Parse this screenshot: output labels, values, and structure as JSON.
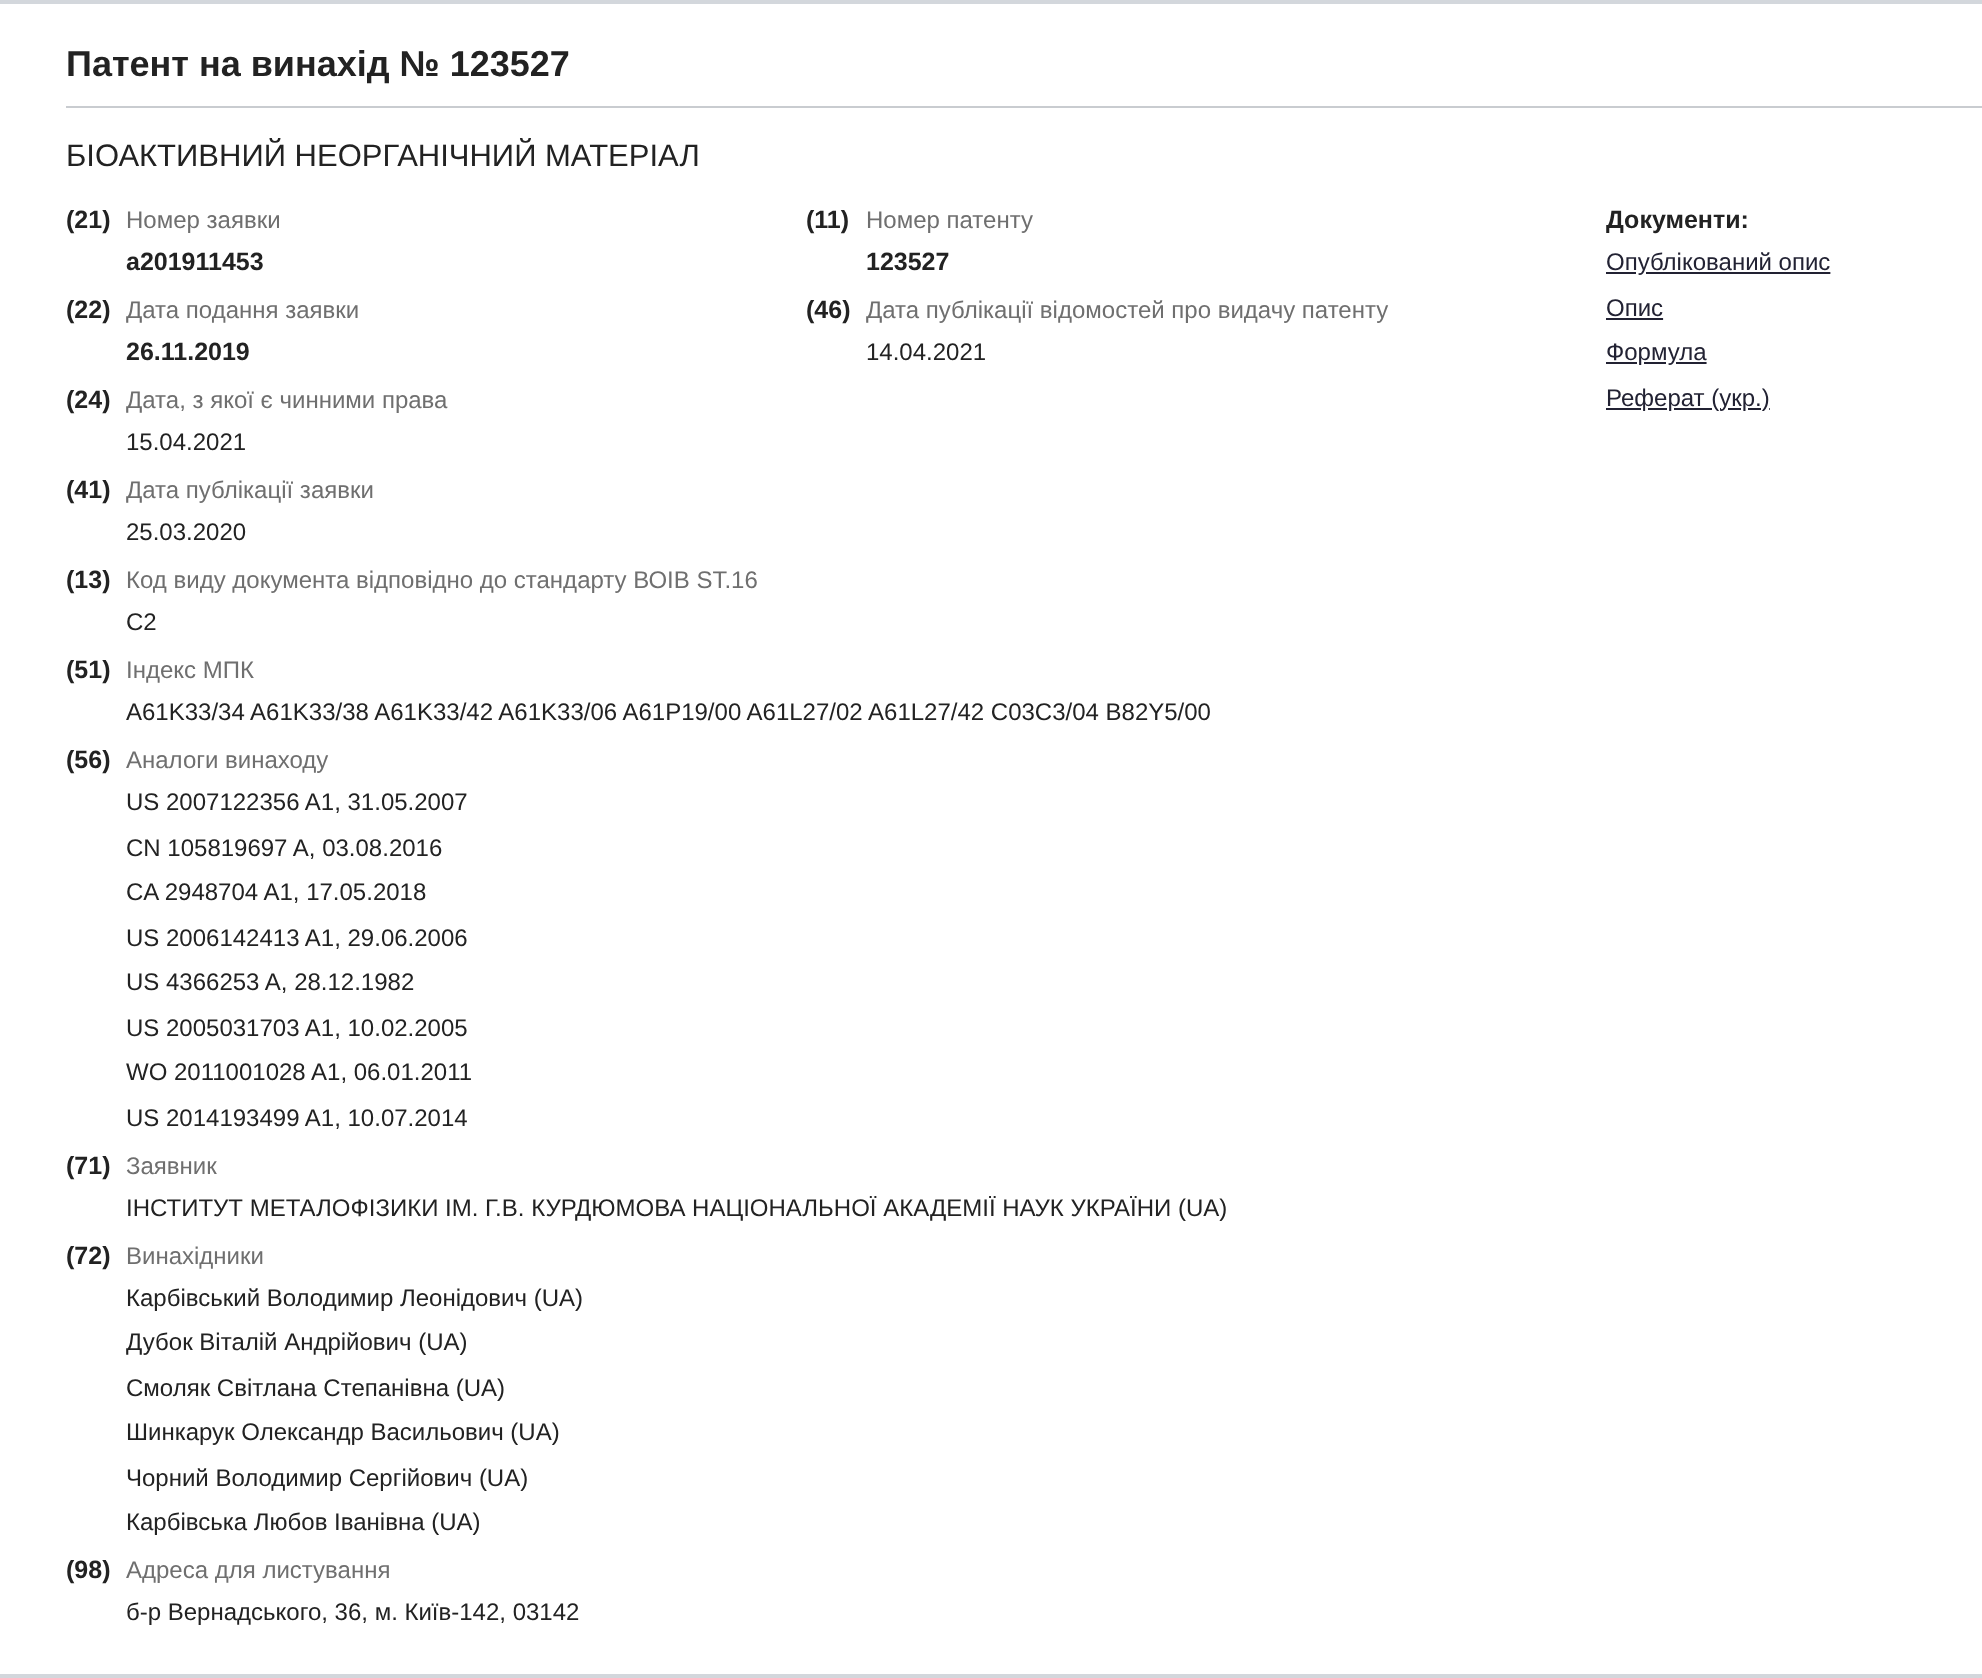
{
  "page_title": "Патент на винахід № 123527",
  "invention_title": "БІОАКТИВНИЙ НЕОРГАНІЧНИЙ МАТЕРІАЛ",
  "top_left_fields": [
    {
      "code": "(21)",
      "label": "Номер заявки",
      "bold": true,
      "values": [
        "a201911453"
      ]
    },
    {
      "code": "(22)",
      "label": "Дата подання заявки",
      "bold": true,
      "values": [
        "26.11.2019"
      ]
    }
  ],
  "top_right_fields": [
    {
      "code": "(11)",
      "label": "Номер патенту",
      "bold": true,
      "values": [
        "123527"
      ]
    },
    {
      "code": "(46)",
      "label": "Дата публікації відомостей про видачу патенту",
      "bold": false,
      "values": [
        "14.04.2021"
      ]
    }
  ],
  "fields": [
    {
      "code": "(24)",
      "label": "Дата, з якої є чинними права",
      "bold": false,
      "values": [
        "15.04.2021"
      ]
    },
    {
      "code": "(41)",
      "label": "Дата публікації заявки",
      "bold": false,
      "values": [
        "25.03.2020"
      ]
    },
    {
      "code": "(13)",
      "label": "Код виду документа відповідно до стандарту ВОІВ ST.16",
      "bold": false,
      "values": [
        "C2"
      ]
    },
    {
      "code": "(51)",
      "label": "Індекс МПК",
      "bold": false,
      "values": [
        "A61K33/34 A61K33/38 A61K33/42 A61K33/06 A61P19/00 A61L27/02 A61L27/42 C03C3/04 B82Y5/00"
      ]
    },
    {
      "code": "(56)",
      "label": "Аналоги винаходу",
      "bold": false,
      "values": [
        "US 2007122356 A1, 31.05.2007",
        "CN 105819697 A, 03.08.2016",
        "CA 2948704 A1, 17.05.2018",
        "US 2006142413 A1, 29.06.2006",
        "US 4366253 A, 28.12.1982",
        "US 2005031703 A1, 10.02.2005",
        "WO 2011001028 A1, 06.01.2011",
        "US 2014193499 A1, 10.07.2014"
      ]
    },
    {
      "code": "(71)",
      "label": "Заявник",
      "bold": false,
      "values": [
        "ІНСТИТУТ МЕТАЛОФІЗИКИ ІМ. Г.В. КУРДЮМОВА НАЦІОНАЛЬНОЇ АКАДЕМІЇ НАУК УКРАЇНИ (UA)"
      ]
    },
    {
      "code": "(72)",
      "label": "Винахідники",
      "bold": false,
      "values": [
        "Карбівський Володимир Леонідович (UA)",
        "Дубок Віталій Андрійович (UA)",
        "Смоляк Світлана Степанівна (UA)",
        "Шинкарук Олександр Васильович (UA)",
        "Чорний Володимир Сергійович (UA)",
        "Карбівська Любов Іванівна (UA)"
      ]
    },
    {
      "code": "(98)",
      "label": "Адреса для листування",
      "bold": false,
      "values": [
        "б-р Вернадського, 36, м. Київ-142, 03142"
      ]
    }
  ],
  "documents": {
    "title": "Документи:",
    "links": [
      "Опублікований опис",
      "Опис",
      "Формула",
      "Реферат (укр.)"
    ]
  }
}
